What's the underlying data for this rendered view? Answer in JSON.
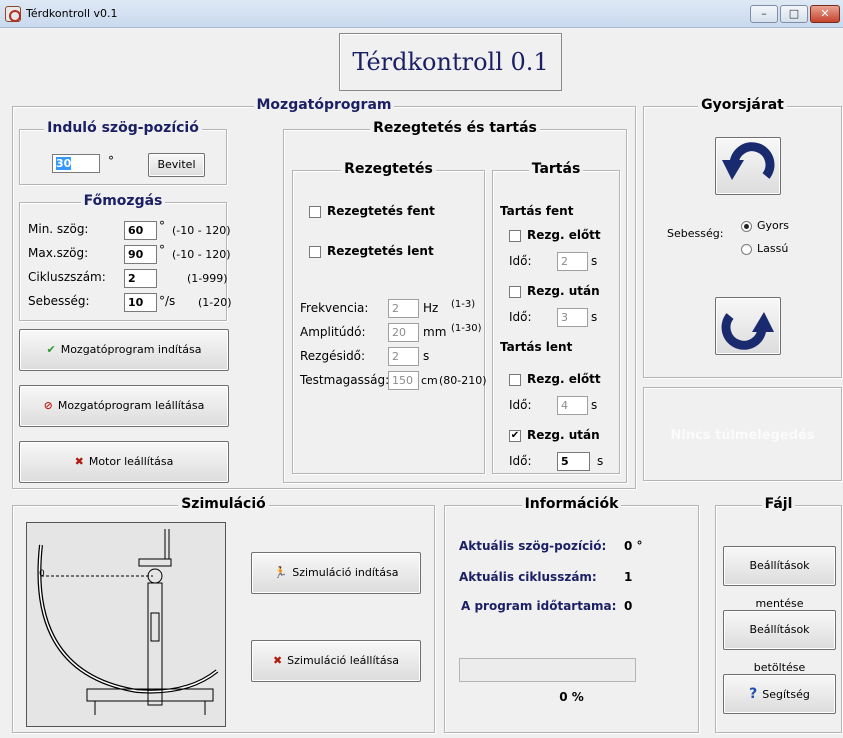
{
  "window": {
    "title": "Térdkontroll v0.1",
    "min": "–",
    "max": "□",
    "close": "✕"
  },
  "header": {
    "title": "Térdkontroll 0.1"
  },
  "program": {
    "title": "Mozgatóprogram",
    "start": {
      "title": "Induló szög-pozíció",
      "value": "30",
      "unit": "°",
      "enter_button": "Bevitel"
    },
    "main_motion": {
      "title": "Főmozgás",
      "rows": [
        {
          "label": "Min. szög:",
          "value": "60",
          "unit": "°",
          "range": "(-10 - 120)"
        },
        {
          "label": "Max.szög:",
          "value": "90",
          "unit": "°",
          "range": "(-10 - 120)"
        },
        {
          "label": "Cikluszszám:",
          "value": "2",
          "unit": "",
          "range": "(1-999)"
        },
        {
          "label": "Sebesség:",
          "value": "10",
          "unit": "°/s",
          "range": "(1-20)"
        }
      ]
    },
    "buttons": {
      "start": "Mozgatóprogram indítása",
      "stop": "Mozgatóprogram leállítása",
      "motor_stop": "Motor leállítása"
    },
    "vibration_hold": {
      "title": "Rezegtetés és tartás",
      "vibration": {
        "title": "Rezegtetés",
        "top": "Rezegtetés fent",
        "bottom": "Rezegtetés lent",
        "freq": {
          "label": "Frekvencia:",
          "value": "2",
          "unit": "Hz",
          "range": "(1-3)"
        },
        "ampl": {
          "label": "Amplitúdó:",
          "value": "20",
          "unit": "mm",
          "range": "(1-30)"
        },
        "time": {
          "label": "Rezgésidő:",
          "value": "2",
          "unit": "s"
        },
        "height": {
          "label": "Testmagasság:",
          "value": "150",
          "unit": "cm",
          "range": "(80-210)"
        }
      },
      "hold": {
        "title": "Tartás",
        "top_title": "Tartás fent",
        "bottom_title": "Tartás lent",
        "before": "Rezg. előtt",
        "after": "Rezg. után",
        "time_label": "Idő:",
        "unit": "s",
        "top_before_time": "2",
        "top_after_time": "3",
        "bottom_before_time": "4",
        "bottom_after_time": "5",
        "bottom_after_checked": "✔"
      }
    }
  },
  "rapid": {
    "title": "Gyorsjárat",
    "speed_label": "Sebesség:",
    "fast": "Gyors",
    "slow": "Lassú"
  },
  "overheat": {
    "text": "Nincs túlmelegedés"
  },
  "simulation": {
    "title": "Szimuláció",
    "start": "Szimuláció indítása",
    "stop": "Szimuláció leállítása",
    "zero_label": "0"
  },
  "info": {
    "title": "Információk",
    "angle_label": "Aktuális szög-pozíció:",
    "angle_value": "0 °",
    "cycle_label": "Aktuális ciklusszám:",
    "cycle_value": "1",
    "duration_label": "A program időtartama:",
    "duration_value": "0",
    "progress_percent": 0,
    "progress_text": "0 %"
  },
  "file": {
    "title": "Fájl",
    "save": "Beállítások mentése",
    "load": "Beállítások betöltése",
    "help": "Segítség"
  }
}
